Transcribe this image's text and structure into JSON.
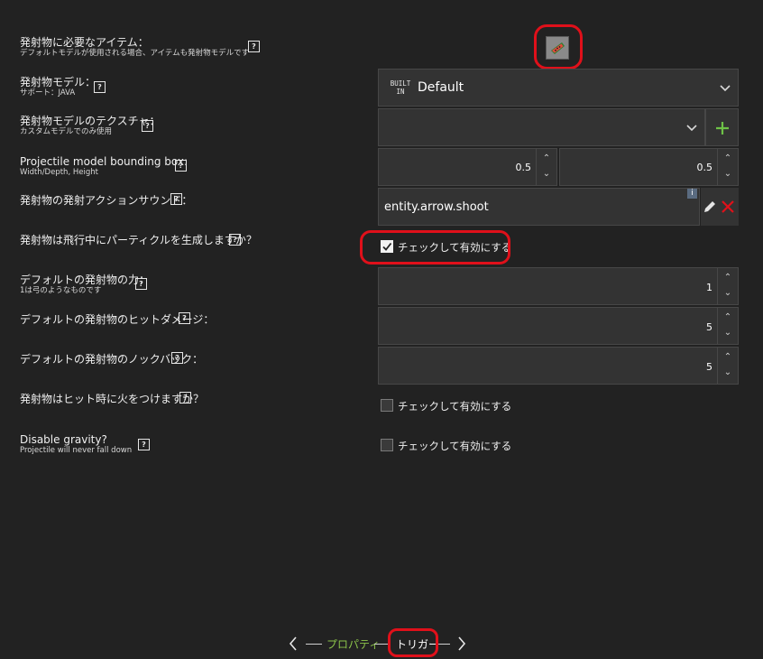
{
  "rows": [
    {
      "label": "発射物に必要なアイテム：",
      "sub": "デフォルトモデルが使用される場合、アイテムも発射物モデルです"
    },
    {
      "label": "発射物モデル：",
      "sub": "サポート：JAVA"
    },
    {
      "label": "発射物モデルのテクスチャ：",
      "sub": "カスタムモデルでのみ使用"
    },
    {
      "label": "Projectile model bounding box:",
      "sub": "Width/Depth, Height"
    },
    {
      "label": "発射物の発射アクションサウンド："
    },
    {
      "label": "発射物は飛行中にパーティクルを生成しますか？"
    },
    {
      "label": "デフォルトの発射物の力：",
      "sub": "1は弓のようなものです"
    },
    {
      "label": "デフォルトの発射物のヒットダメージ："
    },
    {
      "label": "デフォルトの発射物のノックバック："
    },
    {
      "label": "発射物はヒット時に火をつけますか？"
    },
    {
      "label": "Disable gravity?",
      "sub": "Projectile will never fall down"
    }
  ],
  "help_glyph": "?",
  "model_select": {
    "badge_top": "BUILT",
    "badge_bottom": "IN",
    "value": "Default"
  },
  "bbox": {
    "width": "0.5",
    "height": "0.5"
  },
  "sound": {
    "value": "entity.arrow.shoot",
    "info": "i"
  },
  "checkbox_label": "チェックして有効にする",
  "checks": {
    "particles": true,
    "fire": false,
    "gravity": false
  },
  "power": "1",
  "damage": "5",
  "knockback": "5",
  "nav": {
    "prev": "プロパティ",
    "current": "トリガー"
  },
  "colors": {
    "nav_prev": "#8bc34a",
    "add": "#6ec247",
    "remove": "#e0101a",
    "highlight": "#e0101a"
  }
}
